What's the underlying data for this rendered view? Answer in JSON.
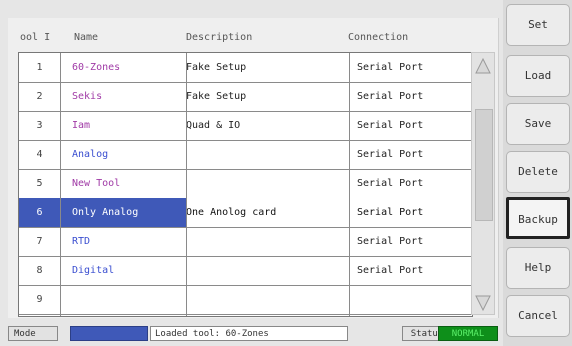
{
  "table": {
    "headers": {
      "idx": "ool I",
      "name": "Name",
      "description": "Description",
      "connection": "Connection"
    },
    "rows": [
      {
        "idx": "1",
        "name": "60-Zones",
        "description": "Fake Setup",
        "connection": "Serial Port",
        "name_color": "#a03aa6"
      },
      {
        "idx": "2",
        "name": "Sekis",
        "description": "Fake Setup",
        "connection": "Serial Port",
        "name_color": "#a03aa6"
      },
      {
        "idx": "3",
        "name": "Iam",
        "description": "Quad & IO",
        "connection": "Serial Port",
        "name_color": "#a03aa6"
      },
      {
        "idx": "4",
        "name": "Analog",
        "description": "",
        "connection": "Serial Port",
        "name_color": "#3b4fd0"
      },
      {
        "idx": "5",
        "name": "New Tool",
        "description": "",
        "connection": "Serial Port",
        "name_color": "#a03aa6"
      },
      {
        "idx": "6",
        "name": "Only Analog",
        "description": "One Anolog card",
        "connection": "Serial Port",
        "name_color": "#ffffff",
        "selected": true
      },
      {
        "idx": "7",
        "name": "RTD",
        "description": "",
        "connection": "Serial Port",
        "name_color": "#3b4fd0"
      },
      {
        "idx": "8",
        "name": "Digital",
        "description": "",
        "connection": "Serial Port",
        "name_color": "#3b4fd0"
      },
      {
        "idx": "9",
        "name": "",
        "description": "",
        "connection": "",
        "name_color": "#3b4fd0"
      }
    ]
  },
  "status": {
    "mode_label": "Mode",
    "loaded_text": "Loaded tool: 60-Zones",
    "status_label": "Status",
    "status_value": "NORMAL"
  },
  "buttons": {
    "set": "Set",
    "load": "Load",
    "save": "Save",
    "delete": "Delete",
    "backup": "Backup",
    "help": "Help",
    "cancel": "Cancel"
  },
  "colors": {
    "selected_row": "#3f59b8",
    "status_normal_bg": "#0e8f1a",
    "status_normal_text": "#5bf06a",
    "mode_blue": "#3f59b8"
  }
}
